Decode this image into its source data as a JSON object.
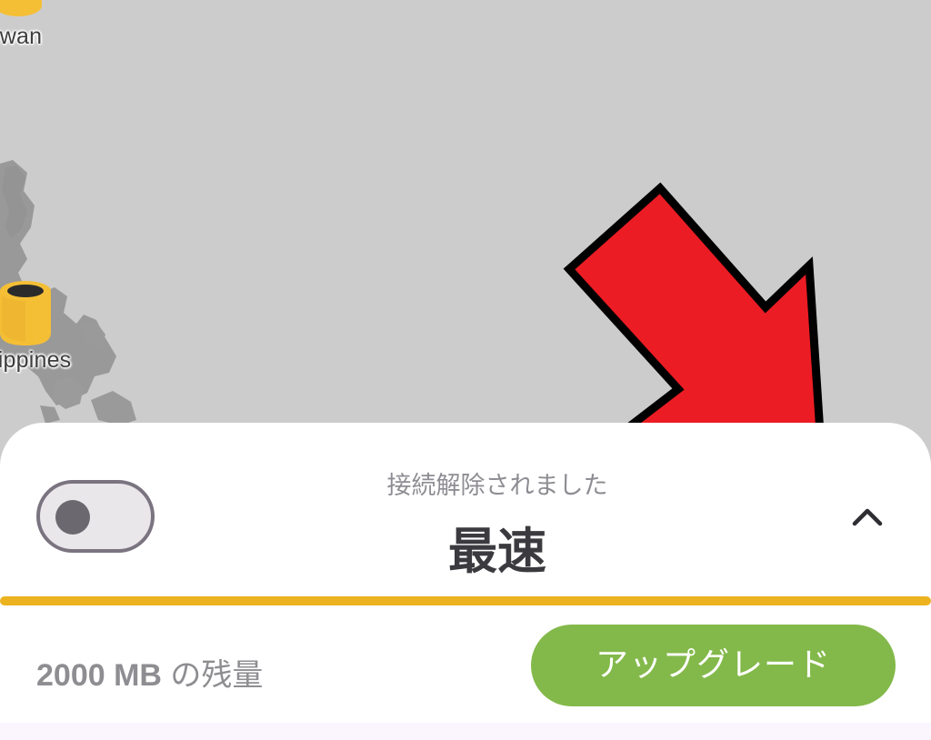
{
  "map": {
    "pins": [
      {
        "name": "taiwan",
        "label": "iwan"
      },
      {
        "name": "philippines",
        "label": "lippines"
      }
    ],
    "land_color": "#999999",
    "pin_color": "#f5bf35",
    "background_color": "#cccccc"
  },
  "annotation": {
    "arrow_color": "#ec1c24",
    "arrow_outline": "#000000"
  },
  "connection_panel": {
    "toggle_state": "off",
    "status": "接続解除されました",
    "server": "最速",
    "expand_icon": "chevron-up-icon",
    "accent_color": "#ecb21f"
  },
  "quota": {
    "amount": "2000 MB",
    "suffix": " の残量"
  },
  "upgrade": {
    "label": "アップグレード",
    "color": "#83b94a"
  }
}
